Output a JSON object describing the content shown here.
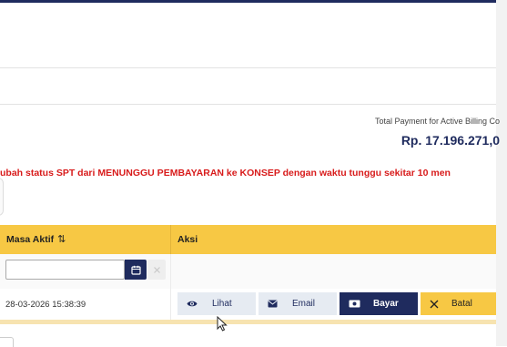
{
  "summary": {
    "total_label": "Total Payment for Active Billing Co",
    "total_amount": "Rp. 17.196.271,0"
  },
  "notice": {
    "text": "ubah status SPT dari MENUNGGU PEMBAYARAN ke KONSEP dengan waktu tunggu sekitar 10 men"
  },
  "table": {
    "columns": [
      {
        "label": "Masa Aktif",
        "sort_icon": "⇅"
      },
      {
        "label": "Aksi"
      }
    ],
    "filter": {
      "date_value": "",
      "date_placeholder": "",
      "calendar_icon": "calendar-icon",
      "clear_icon": "clear-icon"
    },
    "rows": [
      {
        "masa_aktif": "28-03-2026 15:38:39",
        "actions": [
          {
            "label": "Lihat",
            "icon": "eye-icon"
          },
          {
            "label": "Email",
            "icon": "envelope-icon"
          },
          {
            "label": "Bayar",
            "icon": "money-icon"
          },
          {
            "label": "Batal",
            "icon": "close-icon"
          }
        ]
      }
    ]
  },
  "colors": {
    "navy": "#1f2b5e",
    "header_yellow": "#f7c844",
    "notice_red": "#d81b1b",
    "light_button": "#e6ebf2"
  }
}
